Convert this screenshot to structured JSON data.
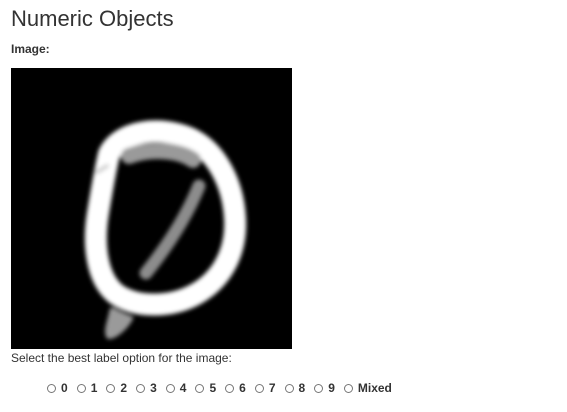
{
  "page": {
    "title": "Numeric Objects",
    "image_label": "Image:",
    "instruction": "Select the best label option for the image:"
  },
  "image": {
    "description_name": "handwritten-digit-image",
    "background_color": "#000000",
    "stroke_color": "#ffffff"
  },
  "options": [
    {
      "label": "0"
    },
    {
      "label": "1"
    },
    {
      "label": "2"
    },
    {
      "label": "3"
    },
    {
      "label": "4"
    },
    {
      "label": "5"
    },
    {
      "label": "6"
    },
    {
      "label": "7"
    },
    {
      "label": "8"
    },
    {
      "label": "9"
    },
    {
      "label": "Mixed"
    }
  ],
  "selected_option": null
}
